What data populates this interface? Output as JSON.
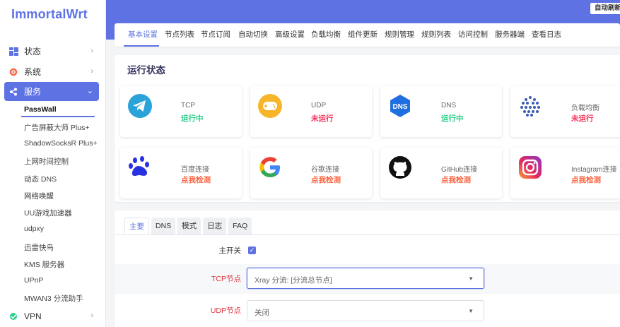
{
  "brand": "ImmortalWrt",
  "header": {
    "auto_refresh": "自动刷新"
  },
  "sidebar": {
    "status": "状态",
    "system": "系统",
    "services": "服务",
    "services_sub": [
      "PassWall",
      "广告屏蔽大师 Plus+",
      "ShadowSocksR Plus+",
      "上网时间控制",
      "动态 DNS",
      "网络唤醒",
      "UU游戏加速器",
      "udpxy",
      "迅雷快鸟",
      "KMS 服务器",
      "UPnP",
      "MWAN3 分流助手"
    ],
    "vpn": "VPN"
  },
  "tabs": [
    "基本设置",
    "节点列表",
    "节点订阅",
    "自动切换",
    "高级设置",
    "负载均衡",
    "组件更新",
    "规则管理",
    "规则列表",
    "访问控制",
    "服务器端",
    "查看日志"
  ],
  "status": {
    "title": "运行状态",
    "tiles": [
      {
        "name": "TCP",
        "state": "运行中",
        "icon": "telegram-icon"
      },
      {
        "name": "UDP",
        "state": "未运行",
        "icon": "gamepad-icon"
      },
      {
        "name": "DNS",
        "state": "运行中",
        "icon": "dns-icon",
        "icon_text": "DNS"
      },
      {
        "name": "负载均衡",
        "state": "未运行",
        "icon": "load-balance-icon"
      },
      {
        "name": "百度连接",
        "state": "点我检测",
        "icon": "baidu-icon"
      },
      {
        "name": "谷歌连接",
        "state": "点我检测",
        "icon": "google-icon"
      },
      {
        "name": "GitHub连接",
        "state": "点我检测",
        "icon": "github-icon"
      },
      {
        "name": "Instagram连接",
        "state": "点我检测",
        "icon": "instagram-icon"
      }
    ]
  },
  "settings": {
    "tabs": [
      "主要",
      "DNS",
      "模式",
      "日志",
      "FAQ"
    ],
    "main_switch_label": "主开关",
    "tcp_label": "TCP节点",
    "tcp_value": "Xray 分流: [分流总节点]",
    "udp_label": "UDP节点",
    "udp_value": "关闭"
  },
  "colors": {
    "accent": "#5e72e4",
    "running": "#2dce89",
    "stopped": "#f5365c",
    "check": "#fb6340"
  }
}
